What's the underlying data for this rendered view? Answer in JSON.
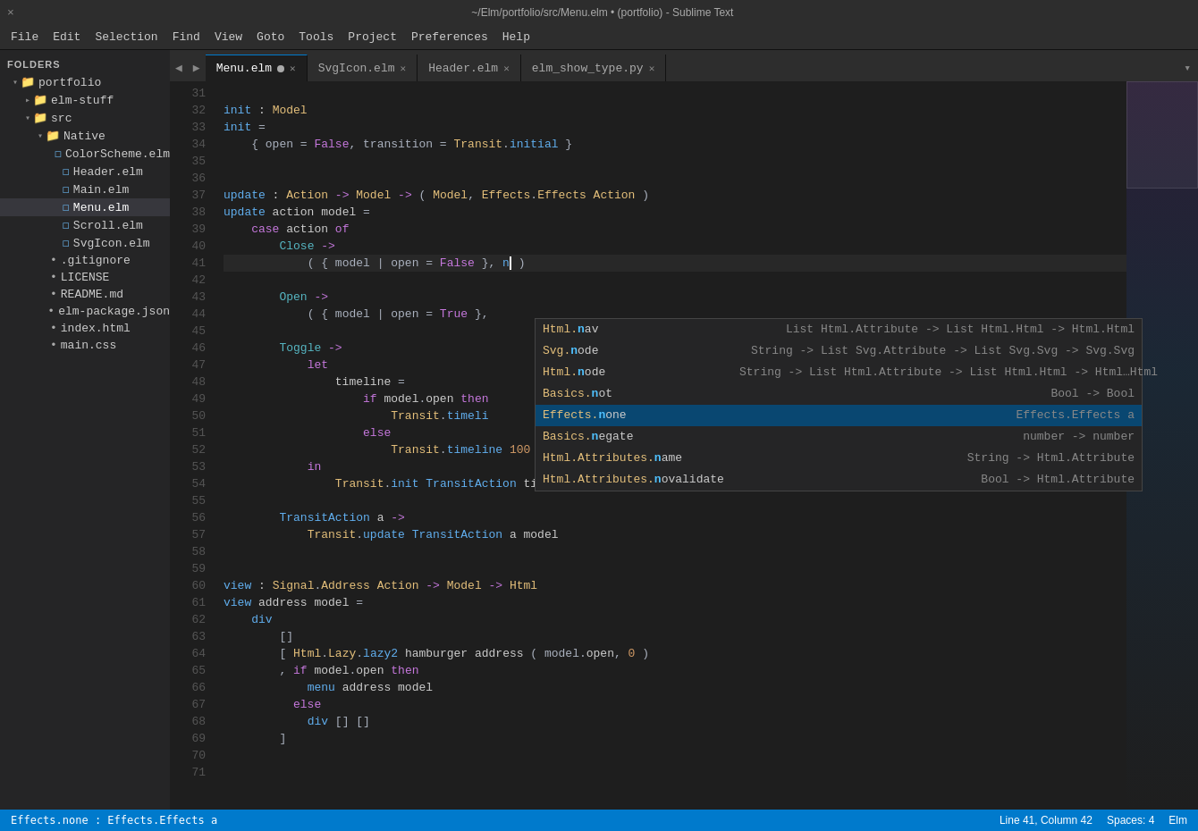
{
  "titlebar": {
    "close": "×",
    "title": "~/Elm/portfolio/src/Menu.elm • (portfolio) - Sublime Text",
    "resize": "❐"
  },
  "menubar": {
    "items": [
      "File",
      "Edit",
      "Selection",
      "Find",
      "View",
      "Goto",
      "Tools",
      "Project",
      "Preferences",
      "Help"
    ]
  },
  "sidebar": {
    "folders_label": "FOLDERS",
    "tree": [
      {
        "indent": 1,
        "type": "folder",
        "open": true,
        "label": "portfolio"
      },
      {
        "indent": 2,
        "type": "folder",
        "open": false,
        "label": "elm-stuff"
      },
      {
        "indent": 2,
        "type": "folder",
        "open": true,
        "label": "src"
      },
      {
        "indent": 3,
        "type": "folder",
        "open": true,
        "label": "Native"
      },
      {
        "indent": 4,
        "type": "file-elm",
        "label": "ColorScheme.elm"
      },
      {
        "indent": 4,
        "type": "file-elm",
        "label": "Header.elm"
      },
      {
        "indent": 4,
        "type": "file-elm",
        "label": "Main.elm"
      },
      {
        "indent": 4,
        "type": "file-elm",
        "selected": true,
        "label": "Menu.elm"
      },
      {
        "indent": 4,
        "type": "file-elm",
        "label": "Scroll.elm"
      },
      {
        "indent": 4,
        "type": "file-elm",
        "label": "SvgIcon.elm"
      },
      {
        "indent": 3,
        "type": "file-other",
        "label": ".gitignore"
      },
      {
        "indent": 3,
        "type": "file-other",
        "label": "LICENSE"
      },
      {
        "indent": 3,
        "type": "file-other",
        "label": "README.md"
      },
      {
        "indent": 3,
        "type": "file-other",
        "label": "elm-package.json"
      },
      {
        "indent": 3,
        "type": "file-other",
        "label": "index.html"
      },
      {
        "indent": 3,
        "type": "file-other",
        "label": "main.css"
      }
    ]
  },
  "tabs": [
    {
      "label": "Menu.elm",
      "active": true,
      "modified": true
    },
    {
      "label": "SvgIcon.elm",
      "active": false,
      "modified": false
    },
    {
      "label": "Header.elm",
      "active": false,
      "modified": false
    },
    {
      "label": "elm_show_type.py",
      "active": false,
      "modified": false
    }
  ],
  "lines": [
    {
      "num": 31,
      "content": ""
    },
    {
      "num": 32,
      "content": "init : Model"
    },
    {
      "num": 33,
      "content": "init ="
    },
    {
      "num": 34,
      "content": "    { open = False, transition = Transit.initial }"
    },
    {
      "num": 35,
      "content": ""
    },
    {
      "num": 36,
      "content": ""
    },
    {
      "num": 37,
      "content": "update : Action -> Model -> ( Model, Effects.Effects Action )"
    },
    {
      "num": 38,
      "content": "update action model ="
    },
    {
      "num": 39,
      "content": "    case action of"
    },
    {
      "num": 40,
      "content": "        Close ->"
    },
    {
      "num": 41,
      "content": "            ( { model | open = False }, n )"
    },
    {
      "num": 42,
      "content": ""
    },
    {
      "num": 43,
      "content": "        Open ->"
    },
    {
      "num": 44,
      "content": "            ( { model | open = True },"
    },
    {
      "num": 45,
      "content": ""
    },
    {
      "num": 46,
      "content": "        Toggle ->"
    },
    {
      "num": 47,
      "content": "            let"
    },
    {
      "num": 48,
      "content": "                timeline ="
    },
    {
      "num": 49,
      "content": "                    if model.open then"
    },
    {
      "num": 50,
      "content": "                        Transit.timeli"
    },
    {
      "num": 51,
      "content": "                    else"
    },
    {
      "num": 52,
      "content": "                        Transit.timeline 100 Open 500"
    },
    {
      "num": 53,
      "content": "            in"
    },
    {
      "num": 54,
      "content": "                Transit.init TransitAction timeline model"
    },
    {
      "num": 55,
      "content": ""
    },
    {
      "num": 56,
      "content": "        TransitAction a ->"
    },
    {
      "num": 57,
      "content": "            Transit.update TransitAction a model"
    },
    {
      "num": 58,
      "content": ""
    },
    {
      "num": 59,
      "content": ""
    },
    {
      "num": 60,
      "content": "view : Signal.Address Action -> Model -> Html"
    },
    {
      "num": 61,
      "content": "view address model ="
    },
    {
      "num": 62,
      "content": "    div"
    },
    {
      "num": 63,
      "content": "        []"
    },
    {
      "num": 64,
      "content": "        [ Html.Lazy.lazy2 hamburger address ( model.open, 0 )"
    },
    {
      "num": 65,
      "content": "        , if model.open then"
    },
    {
      "num": 66,
      "content": "            menu address model"
    },
    {
      "num": 67,
      "content": "          else"
    },
    {
      "num": 68,
      "content": "            div [] []"
    },
    {
      "num": 69,
      "content": "        ]"
    },
    {
      "num": 70,
      "content": ""
    },
    {
      "num": 71,
      "content": ""
    }
  ],
  "autocomplete": {
    "items": [
      {
        "module": "Html",
        "name": "nav",
        "match": "n",
        "type": "List Html.Attribute -> List Html.Html -> Html.Html"
      },
      {
        "module": "Svg",
        "name": "node",
        "match": "n",
        "type": "String -> List Svg.Attribute -> List Svg.Svg -> Svg.Svg"
      },
      {
        "module": "Html",
        "name": "node",
        "match": "n",
        "type": "String -> List Html.Attribute -> List Html.Html -> Html…Html"
      },
      {
        "module": "Basics",
        "name": "not",
        "match": "n",
        "type": "Bool -> Bool"
      },
      {
        "module": "Effects",
        "name": "none",
        "match": "n",
        "selected": true,
        "type": "Effects.Effects a"
      },
      {
        "module": "Basics",
        "name": "negate",
        "match": "n",
        "type": "number -> number"
      },
      {
        "module": "Html.Attributes",
        "name": "name",
        "match": "n",
        "type": "String -> Html.Attribute"
      },
      {
        "module": "Html.Attributes",
        "name": "novalidate",
        "match": "n",
        "type": "Bool -> Html.Attribute"
      }
    ]
  },
  "statusbar": {
    "left": "1",
    "status_text": "Effects.none : Effects.Effects a",
    "line_col": "Line 41, Column 42",
    "spaces": "Spaces: 4",
    "syntax": "Elm"
  }
}
